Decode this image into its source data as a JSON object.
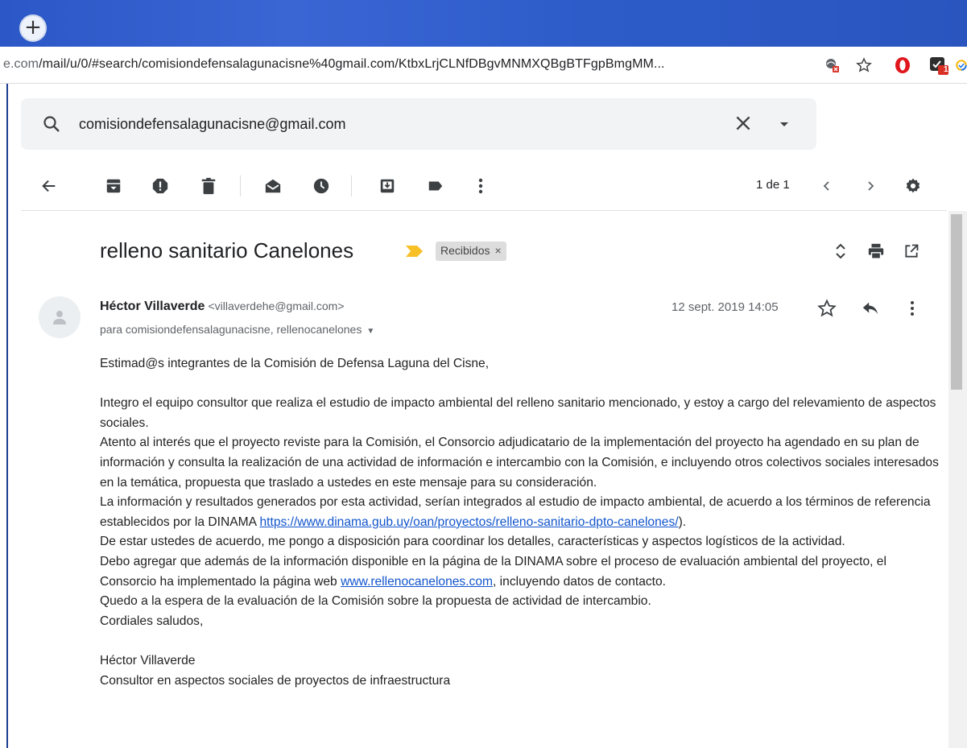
{
  "browser": {
    "new_tab_label": "+",
    "url_prefix": "e.com",
    "url_rest": "/mail/u/0/#search/comisiondefensalagunacisne%40gmail.com/KtbxLrjCLNfDBgvMNMXQBgBTFgpBmgMM...",
    "extension_badge": "1"
  },
  "search": {
    "query": "comisiondefensalagunacisne@gmail.com"
  },
  "toolbar": {
    "pager": "1 de 1"
  },
  "message": {
    "subject": "relleno sanitario Canelones",
    "label": "Recibidos",
    "label_remove": "×",
    "sender_name": "Héctor Villaverde",
    "sender_email": "<villaverdehe@gmail.com>",
    "recipients": "para comisiondefensalagunacisne, rellenocanelones",
    "date": "12 sept. 2019 14:05",
    "body": {
      "greeting": "Estimad@s integrantes de la Comisión de Defensa Laguna del Cisne,",
      "p1": "Integro el equipo consultor que realiza el estudio de impacto ambiental del relleno sanitario mencionado, y estoy a cargo del relevamiento de aspectos sociales.",
      "p2": "Atento al interés que el proyecto reviste para la Comisión, el Consorcio adjudicatario de la implementación del proyecto ha agendado en su plan de información y consulta la realización de una actividad de información e intercambio con la Comisión, e incluyendo otros colectivos sociales interesados en la temática, propuesta que traslado a ustedes en este mensaje para su consideración.",
      "p3_before": "La información y resultados generados por esta actividad, serían integrados al estudio de impacto ambiental, de acuerdo a los términos de referencia establecidos por la DINAMA ",
      "p3_link": "https://www.dinama.gub.uy/oan/proyectos/relleno-sanitario-dpto-canelones/",
      "p3_after": ").",
      "p4": "De estar ustedes de acuerdo, me pongo a disposición para coordinar los detalles, características y aspectos logísticos de la actividad.",
      "p5_before": "Debo agregar que además de la información disponible en la página de la DINAMA sobre el proceso de evaluación ambiental del proyecto, el Consorcio ha implementado la página web ",
      "p5_link": "www.rellenocanelones.com",
      "p5_after": ", incluyendo datos de contacto.",
      "p6": "Quedo a la espera de la evaluación de la Comisión sobre la propuesta de actividad de intercambio.",
      "p7": "Cordiales saludos,",
      "sig_name": "Héctor Villaverde",
      "sig_title": "Consultor en aspectos sociales de proyectos de infraestructura"
    }
  }
}
